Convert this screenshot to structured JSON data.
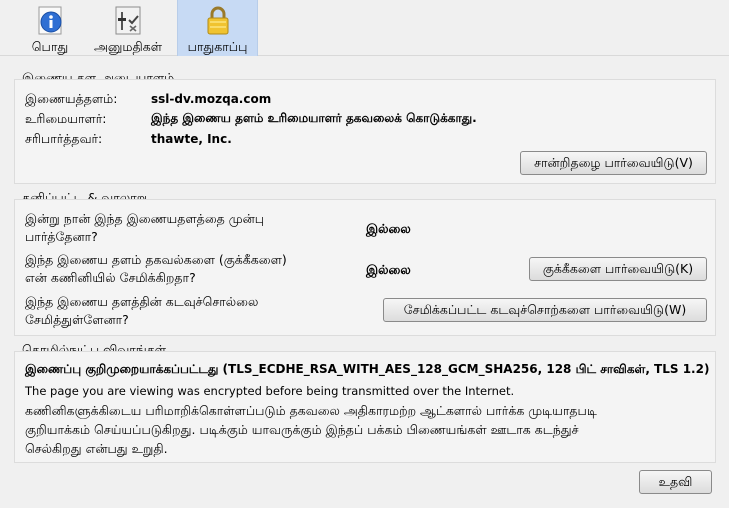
{
  "tabs": [
    {
      "label": "பொது",
      "icon": "info-icon",
      "selected": false
    },
    {
      "label": "அனுமதிகள்",
      "icon": "permissions-icon",
      "selected": false
    },
    {
      "label": "பாதுகாப்பு",
      "icon": "lock-icon",
      "selected": true
    }
  ],
  "identity": {
    "title": "இணைய தள அடையாளம்",
    "website_label": "இணையத்தளம்:",
    "website_value": "ssl-dv.mozqa.com",
    "owner_label": "உரிமையாளர்:",
    "owner_value": "இந்த இணைய தளம் உரிமையாளர் தகவலைக் கொடுக்காது.",
    "verifier_label": "சரிபார்த்தவர்:",
    "verifier_value": "thawte, Inc.",
    "view_cert_button": "சான்றிதழை பார்வையிடு(V)"
  },
  "privacy": {
    "title": "தனிப்பட்ட & வரலாறு",
    "q1_line1": "இன்று நான் இந்த இணையதளத்தை முன்பு",
    "q1_line2": "பார்த்தேனா?",
    "a1": "இல்லை",
    "q2_line1": "இந்த இணைய தளம் தகவல்களை (குக்கீகளை)",
    "q2_line2": "என் கணினியில் சேமிக்கிறதா?",
    "a2": "இல்லை",
    "cookies_button": "குக்கீகளை பார்வையிடு(K)",
    "q3_line1": "இந்த இணைய தளத்தின் கடவுச்சொல்லை",
    "q3_line2": "சேமித்துள்ளேனா?",
    "passwords_button": "சேமிக்கப்பட்ட கடவுச்சொற்களை பார்வையிடு(W)"
  },
  "technical": {
    "title": "தொழில்நுட்ப விவரங்கள்",
    "encryption_line": "இணைப்பு குறிமுறையாக்கப்பட்டது (TLS_ECDHE_RSA_WITH_AES_128_GCM_SHA256, 128 பிட் சாவிகள், TLS 1.2)",
    "english_line": "The page you are viewing was encrypted before being transmitted over the Internet.",
    "desc_line1": "கணினிகளுக்கிடைய பரிமாறிக்கொள்ளப்படும் தகவலை அதிகாரமற்ற ஆட்களால் பார்க்க முடியாதபடி",
    "desc_line2": "குறியாக்கம் செய்யப்படுகிறது. படிக்கும் யாவருக்கும் இந்தப் பக்கம் பிணையங்கள் ஊடாக கடந்துச்",
    "desc_line3": "செல்கிறது என்பது உறுதி."
  },
  "help_button": "உதவி"
}
